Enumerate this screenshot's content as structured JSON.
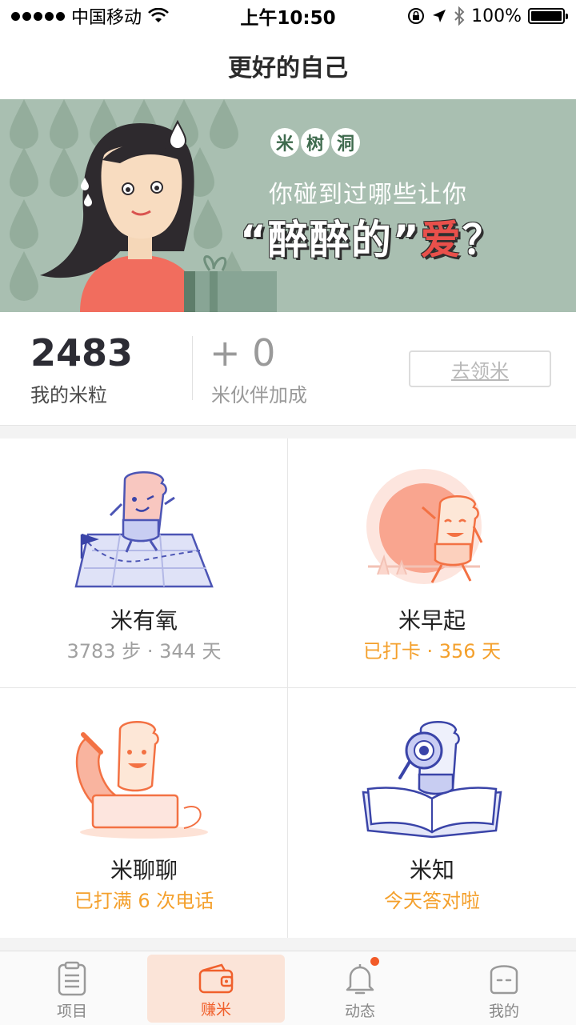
{
  "status_bar": {
    "carrier": "中国移动",
    "time": "上午10:50",
    "battery": "100%",
    "icons": [
      "signal-icon",
      "wifi-icon",
      "orientation-lock-icon",
      "location-icon",
      "bluetooth-icon",
      "battery-icon"
    ]
  },
  "nav": {
    "title": "更好的自己"
  },
  "banner": {
    "tag_chars": [
      "米",
      "树",
      "洞"
    ],
    "line1": "你碰到过哪些让你",
    "line2_prefix": "“醉醉的”",
    "line2_love": "爱",
    "line2_suffix": "？"
  },
  "stats": {
    "rice_value": "2483",
    "rice_label": "我的米粒",
    "bonus_value": "+ 0",
    "bonus_label": "米伙伴加成",
    "claim_label": "去领米"
  },
  "grid": [
    {
      "title": "米有氧",
      "subtitle": "3783 步 · 344 天",
      "icon": "walking-map-icon"
    },
    {
      "title": "米早起",
      "subtitle": "已打卡 · 356 天",
      "icon": "sunrise-icon"
    },
    {
      "title": "米聊聊",
      "subtitle": "已打满 6 次电话",
      "icon": "phone-call-icon"
    },
    {
      "title": "米知",
      "subtitle": "今天答对啦",
      "icon": "reading-book-icon"
    }
  ],
  "tabbar": {
    "items": [
      {
        "label": "项目",
        "icon": "clipboard-icon"
      },
      {
        "label": "赚米",
        "icon": "wallet-icon"
      },
      {
        "label": "动态",
        "icon": "bell-icon"
      },
      {
        "label": "我的",
        "icon": "profile-face-icon"
      }
    ],
    "active_index": 1
  },
  "colors": {
    "accent": "#f0602c",
    "banner_bg": "#a9bfb1",
    "subtitle_orange": "#f4a02c",
    "subtitle_grey": "#a0a0a0"
  }
}
